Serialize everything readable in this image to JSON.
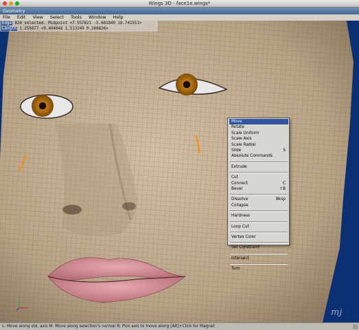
{
  "window": {
    "title": "Wings 3D - face1e.wings*"
  },
  "geometry_tab": "Geometry",
  "menubar": [
    "File",
    "Edit",
    "View",
    "Select",
    "Tools",
    "Window",
    "Help"
  ],
  "info": {
    "line1_label": "Edge",
    "line1_text": "824 selected. Midpoint <7.557621 -5.681849 18.741551>",
    "line2_label": "Length",
    "line2_text": "1.255877 <0.404048 1.513249 0.268826>"
  },
  "menu": {
    "items": [
      {
        "label": "Move",
        "shortcut": "",
        "selected": true,
        "sep_before": false
      },
      {
        "label": "Rotate",
        "shortcut": "",
        "selected": false,
        "sep_before": false
      },
      {
        "label": "Scale Uniform",
        "shortcut": "",
        "selected": false,
        "sep_before": false
      },
      {
        "label": "Scale Axis",
        "shortcut": "",
        "selected": false,
        "sep_before": false
      },
      {
        "label": "Scale Radial",
        "shortcut": "",
        "selected": false,
        "sep_before": false
      },
      {
        "label": "Slide",
        "shortcut": "S",
        "selected": false,
        "sep_before": false
      },
      {
        "label": "Absolute Commands",
        "shortcut": "",
        "selected": false,
        "sep_before": false
      },
      {
        "label": "Extrude",
        "shortcut": "",
        "selected": false,
        "sep_before": true
      },
      {
        "label": "Cut",
        "shortcut": "",
        "selected": false,
        "sep_before": true
      },
      {
        "label": "Connect",
        "shortcut": "C",
        "selected": false,
        "sep_before": false
      },
      {
        "label": "Bevel",
        "shortcut": "⇧B",
        "selected": false,
        "sep_before": false
      },
      {
        "label": "Dissolve",
        "shortcut": "Bksp",
        "selected": false,
        "sep_before": true
      },
      {
        "label": "Collapse",
        "shortcut": "",
        "selected": false,
        "sep_before": false
      },
      {
        "label": "Hardness",
        "shortcut": "",
        "selected": false,
        "sep_before": true
      },
      {
        "label": "Loop Cut",
        "shortcut": "",
        "selected": false,
        "sep_before": true
      },
      {
        "label": "Vertex Color",
        "shortcut": "",
        "selected": false,
        "sep_before": true
      },
      {
        "label": "Set Constraint",
        "shortcut": "",
        "selected": false,
        "sep_before": true
      },
      {
        "label": "Intersect",
        "shortcut": "",
        "selected": false,
        "sep_before": true
      },
      {
        "label": "Turn",
        "shortcut": "",
        "selected": false,
        "sep_before": true
      }
    ]
  },
  "statusbar": "L: Move along std. axis   M: Move along selection's normal   R: Pick axis to move along   [Alt]+Click for Magnet",
  "colors": {
    "background": "#0b2f73",
    "skin": "#c5b094",
    "lips": "#c9808a",
    "iris": "#a0660e",
    "selection_highlight": "#2f54a1",
    "selected_edge": "#ff8c00"
  }
}
